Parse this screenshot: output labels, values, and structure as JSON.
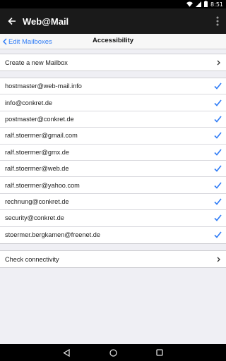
{
  "status": {
    "time": "8:51",
    "icons": [
      "wifi-icon",
      "signal-icon",
      "battery-icon"
    ]
  },
  "app_bar": {
    "title": "Web@Mail",
    "back_icon": "arrow-back-icon",
    "menu_icon": "overflow-menu-icon"
  },
  "nav": {
    "back_label": "Edit Mailboxes",
    "title": "Accessibility"
  },
  "create": {
    "label": "Create a new Mailbox"
  },
  "mailboxes": [
    {
      "address": "hostmaster@web-mail.info",
      "checked": true
    },
    {
      "address": "info@conkret.de",
      "checked": true
    },
    {
      "address": "postmaster@conkret.de",
      "checked": true
    },
    {
      "address": "ralf.stoermer@gmail.com",
      "checked": true
    },
    {
      "address": "ralf.stoermer@gmx.de",
      "checked": true
    },
    {
      "address": "ralf.stoermer@web.de",
      "checked": true
    },
    {
      "address": "ralf.stoermer@yahoo.com",
      "checked": true
    },
    {
      "address": "rechnung@conkret.de",
      "checked": true
    },
    {
      "address": "security@conkret.de",
      "checked": true
    },
    {
      "address": "stoermer.bergkamen@freenet.de",
      "checked": true
    }
  ],
  "check": {
    "label": "Check connectivity"
  },
  "colors": {
    "accent": "#2f7cf6",
    "app_bar": "#1a1a1a",
    "background": "#efeff4"
  }
}
